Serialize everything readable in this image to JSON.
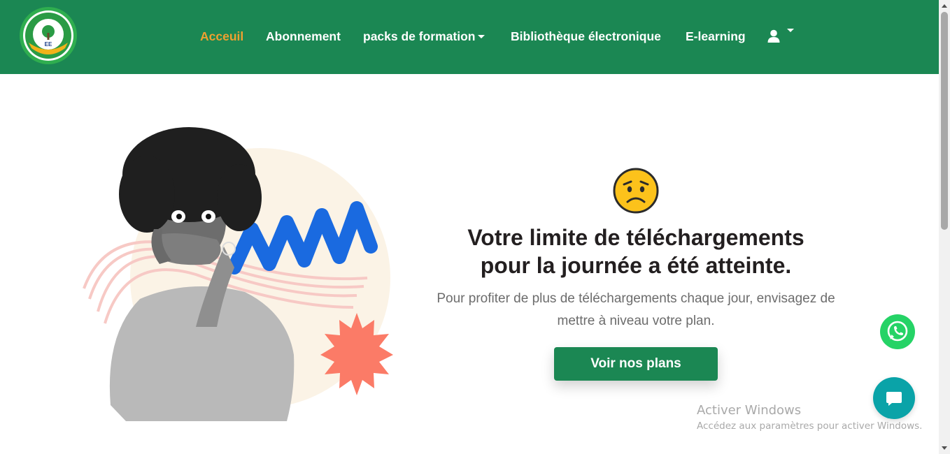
{
  "brand": {
    "logo_text_top": "EPREUVE EXPRESS",
    "logo_text_bottom": "TRAVAIL • SUCCES",
    "logo_initials": "EE"
  },
  "nav": {
    "items": [
      {
        "label": "Acceuil",
        "active": true
      },
      {
        "label": "Abonnement"
      },
      {
        "label": "packs de formation",
        "dropdown": true
      },
      {
        "label": "Bibliothèque électronique"
      },
      {
        "label": "E-learning"
      }
    ],
    "user_icon": "user-icon"
  },
  "hero": {
    "emoji": "worried-face-icon",
    "headline_line1": "Votre limite de téléchargements",
    "headline_line2": "pour la journée a été atteinte.",
    "subtext_line1": "Pour profiter de plus de téléchargements chaque jour, envisagez de",
    "subtext_line2": "mettre à niveau votre plan.",
    "cta_label": "Voir nos plans"
  },
  "floating": {
    "whatsapp_icon": "whatsapp-icon",
    "chat_icon": "chat-bubble-icon"
  },
  "watermark": {
    "title": "Activer Windows",
    "subtitle": "Accédez aux paramètres pour activer Windows."
  },
  "colors": {
    "primary": "#1b8753",
    "active_nav": "#f0a030",
    "cta_text": "#ffffff",
    "whatsapp": "#25d366",
    "chat": "#0aa3a8"
  }
}
